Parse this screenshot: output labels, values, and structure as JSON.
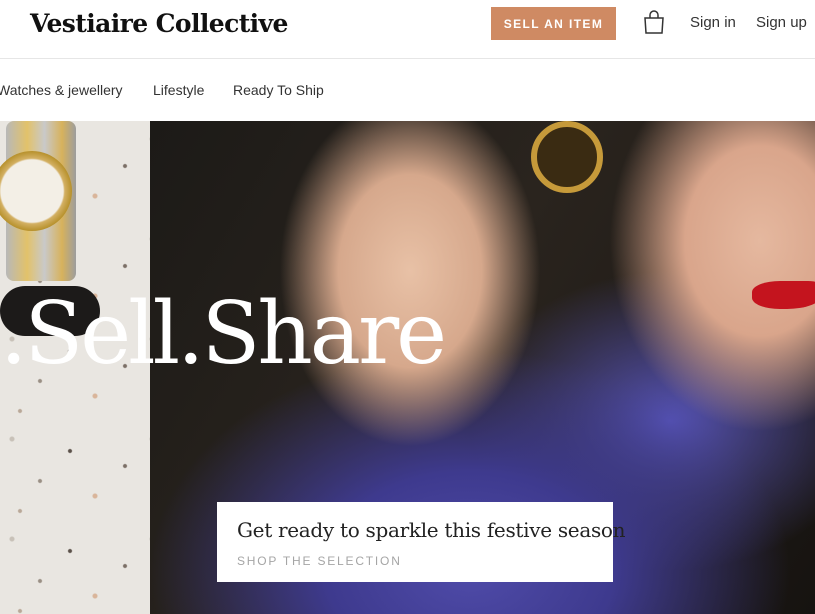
{
  "header": {
    "logo": "Vestiaire Collective",
    "sell_button": "SELL AN ITEM",
    "bag_icon": "shopping-bag-icon",
    "sign_in": "Sign in",
    "sign_up": "Sign up"
  },
  "nav": {
    "items": [
      {
        "label": "Watches & jewellery"
      },
      {
        "label": "Lifestyle"
      },
      {
        "label": "Ready To Ship"
      }
    ]
  },
  "hero": {
    "headline": ".Sell.Share",
    "promo_title": "Get ready to sparkle this festive season",
    "promo_link": "SHOP THE SELECTION"
  },
  "colors": {
    "accent": "#cf8a63",
    "text": "#333333",
    "muted": "#a5a5a5"
  }
}
